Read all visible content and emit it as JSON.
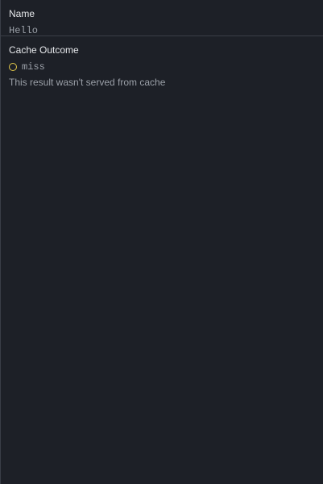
{
  "name_section": {
    "label": "Name",
    "value": "Hello"
  },
  "cache_section": {
    "label": "Cache Outcome",
    "outcome": "miss",
    "outcome_color": "#e3c84b",
    "description": "This result wasn't served from cache"
  }
}
